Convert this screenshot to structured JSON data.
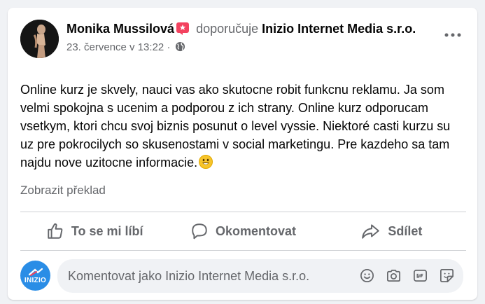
{
  "post": {
    "author": "Monika Mussilová",
    "verb": "doporučuje",
    "page_name": "Inizio Internet Media s.r.o.",
    "timestamp": "23. července v 13:22",
    "separator": "·",
    "body": "Online kurz je skvely, nauci vas ako skutocne robit funkcnu reklamu. Ja som velmi spokojna s ucenim a podporou z ich strany. Online kurz odporucam vsetkym, ktori chcu svoj biznis posunut o level vyssie. Niektoré casti kurzu su uz pre pokrocilych so skusenostami v social marketingu. Pre kazdeho sa tam najdu nove uzitocne informacie.",
    "translate_label": "Zobrazit překlad"
  },
  "actions": {
    "like_label": "To se mi líbí",
    "comment_label": "Okomentovat",
    "share_label": "Sdílet"
  },
  "comment": {
    "placeholder": "Komentovat jako Inizio Internet Media s.r.o.",
    "page_avatar_text": "INIZIO"
  },
  "icons": {
    "badge": "recommendation-star-icon",
    "privacy": "globe-icon",
    "more": "more-dots-icon",
    "like": "thumbs-up-icon",
    "comment": "comment-bubble-icon",
    "share": "share-arrow-icon",
    "emoji": "smiley-icon",
    "camera": "camera-icon",
    "gif": "gif-icon",
    "sticker": "sticker-icon"
  },
  "colors": {
    "badge": "#f3425f",
    "secondary_text": "#65676b",
    "page_avatar": "#2a8de6"
  }
}
